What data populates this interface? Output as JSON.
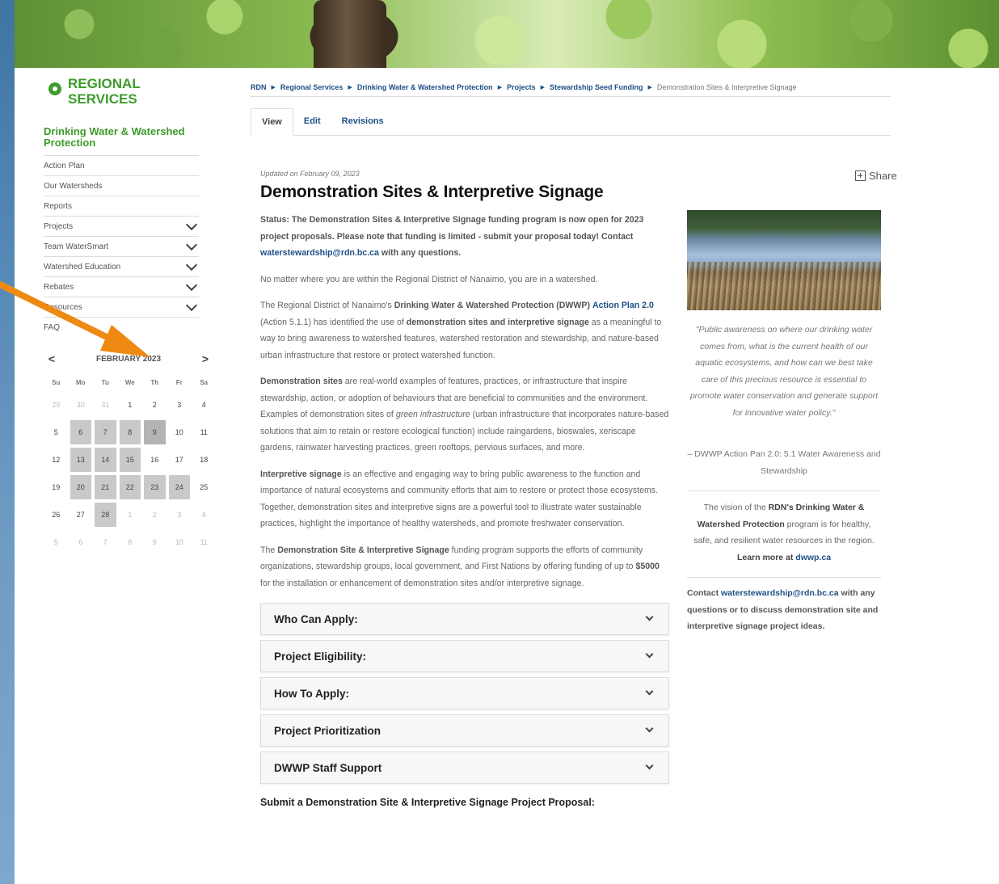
{
  "sidebar": {
    "logo_line1": "REGIONAL",
    "logo_line2": "SERVICES",
    "section_title": "Drinking Water & Watershed Protection",
    "items": [
      {
        "label": "Action Plan",
        "expandable": false
      },
      {
        "label": "Our Watersheds",
        "expandable": false
      },
      {
        "label": "Reports",
        "expandable": false
      },
      {
        "label": "Projects",
        "expandable": true
      },
      {
        "label": "Team WaterSmart",
        "expandable": true
      },
      {
        "label": "Watershed Education",
        "expandable": true
      },
      {
        "label": "Rebates",
        "expandable": true
      },
      {
        "label": "Resources",
        "expandable": true
      },
      {
        "label": "FAQ",
        "expandable": false
      }
    ]
  },
  "calendar": {
    "month_label": "FEBRUARY 2023",
    "prev": "<",
    "next": ">",
    "weekdays": [
      "Su",
      "Mo",
      "Tu",
      "We",
      "Th",
      "Fr",
      "Sa"
    ],
    "weeks": [
      [
        {
          "d": "29",
          "s": "mut"
        },
        {
          "d": "30",
          "s": "mut"
        },
        {
          "d": "31",
          "s": "mut"
        },
        {
          "d": "1",
          "s": ""
        },
        {
          "d": "2",
          "s": ""
        },
        {
          "d": "3",
          "s": ""
        },
        {
          "d": "4",
          "s": ""
        }
      ],
      [
        {
          "d": "5",
          "s": ""
        },
        {
          "d": "6",
          "s": "hl"
        },
        {
          "d": "7",
          "s": "hl"
        },
        {
          "d": "8",
          "s": "hl"
        },
        {
          "d": "9",
          "s": "hl2"
        },
        {
          "d": "10",
          "s": ""
        },
        {
          "d": "11",
          "s": ""
        }
      ],
      [
        {
          "d": "12",
          "s": ""
        },
        {
          "d": "13",
          "s": "hl"
        },
        {
          "d": "14",
          "s": "hl"
        },
        {
          "d": "15",
          "s": "hl"
        },
        {
          "d": "16",
          "s": ""
        },
        {
          "d": "17",
          "s": ""
        },
        {
          "d": "18",
          "s": ""
        }
      ],
      [
        {
          "d": "19",
          "s": ""
        },
        {
          "d": "20",
          "s": "hl"
        },
        {
          "d": "21",
          "s": "hl"
        },
        {
          "d": "22",
          "s": "hl"
        },
        {
          "d": "23",
          "s": "hl"
        },
        {
          "d": "24",
          "s": "hl"
        },
        {
          "d": "25",
          "s": ""
        }
      ],
      [
        {
          "d": "26",
          "s": ""
        },
        {
          "d": "27",
          "s": ""
        },
        {
          "d": "28",
          "s": "hl"
        },
        {
          "d": "1",
          "s": "mut"
        },
        {
          "d": "2",
          "s": "mut"
        },
        {
          "d": "3",
          "s": "mut"
        },
        {
          "d": "4",
          "s": "mut"
        }
      ],
      [
        {
          "d": "5",
          "s": "mut"
        },
        {
          "d": "6",
          "s": "mut"
        },
        {
          "d": "7",
          "s": "mut"
        },
        {
          "d": "8",
          "s": "mut"
        },
        {
          "d": "9",
          "s": "mut"
        },
        {
          "d": "10",
          "s": "mut"
        },
        {
          "d": "11",
          "s": "mut"
        }
      ]
    ]
  },
  "breadcrumb": {
    "items": [
      "RDN",
      "Regional Services",
      "Drinking Water & Watershed Protection",
      "Projects",
      "Stewardship Seed Funding"
    ],
    "current": "Demonstration Sites & Interpretive Signage"
  },
  "tabs": [
    {
      "label": "View",
      "active": true
    },
    {
      "label": "Edit",
      "active": false
    },
    {
      "label": "Revisions",
      "active": false
    }
  ],
  "main": {
    "updated": "Updated on February 09, 2023",
    "title": "Demonstration Sites & Interpretive Signage",
    "status_text": "Status: The Demonstration Sites & Interpretive Signage funding program is now open for 2023 project proposals. Please note that funding is limited - submit your proposal today! Contact ",
    "status_email": "waterstewardship@rdn.bc.ca",
    "status_tail": " with any questions.",
    "p1": "No matter where you are within the Regional District of Nanaimo, you are in a watershed.",
    "p2_a": "The Regional District of Nanaimo's ",
    "p2_b": "Drinking Water & Watershed Protection (DWWP)",
    "p2_link": "Action Plan 2.0",
    "p2_c": " (Action 5.1.1) has identified the use of ",
    "p2_d": "demonstration sites and interpretive signage",
    "p2_e": " as a meaningful to way to bring awareness to watershed features, watershed restoration and stewardship, and nature-based urban infrastructure that restore or protect watershed function.",
    "p3_a": "Demonstration sites",
    "p3_b": " are real-world examples of features, practices, or infrastructure that inspire stewardship, action, or adoption of behaviours that are beneficial to communities and the environment. Examples of demonstration sites of ",
    "p3_c": "green infrastructure",
    "p3_d": " (urban infrastructure that incorporates nature-based solutions that aim to retain or restore ecological function) include raingardens, bioswales, xeriscape gardens, rainwater harvesting practices, green rooftops, pervious surfaces, and more.",
    "p4_a": "Interpretive signage",
    "p4_b": " is an effective and engaging way to bring public awareness to the function and importance of natural ecosystems and community efforts that aim to restore or protect those ecosystems. Together, demonstration sites and interpretive signs are a powerful tool to illustrate water sustainable practices, highlight the importance of healthy watersheds, and promote freshwater conservation.",
    "p5_a": "The ",
    "p5_b": "Demonstration Site & Interpretive Signage",
    "p5_c": " funding program supports the efforts of community organizations, stewardship groups, local government, and First Nations by offering funding of up to ",
    "p5_d": "$5000",
    "p5_e": " for the installation or enhancement of demonstration sites and/or interpretive signage.",
    "accordion": [
      "Who Can Apply:",
      "Project Eligibility:",
      "How To Apply:",
      "Project Prioritization",
      "DWWP Staff Support"
    ],
    "submit_heading": "Submit a Demonstration Site & Interpretive Signage Project Proposal:"
  },
  "aside": {
    "share_label": "Share",
    "quote": "\"Public awareness on where our drinking water comes from, what is the current health of our aquatic ecosystems, and how can we best take care of this precious resource is essential to promote water conservation and generate support for innovative water policy.\"",
    "attribution": "– DWWP Action Pan 2.0: 5.1 Water Awareness and Stewardship",
    "vision_a": "The vision of the ",
    "vision_b": "RDN's Drinking Water & Watershed Protection",
    "vision_c": " program is for healthy, safe, and resilient water resources in the region. ",
    "vision_d": "Learn more at ",
    "vision_link": "dwwp.ca",
    "contact_a": "Contact ",
    "contact_email": "waterstewardship@rdn.bc.ca",
    "contact_b": " with any questions or to discuss demonstration site and interpretive signage project ideas."
  },
  "colors": {
    "brand_green": "#3d9b2a",
    "link_blue": "#1d4f86",
    "arrow_orange": "#ee8a12"
  }
}
